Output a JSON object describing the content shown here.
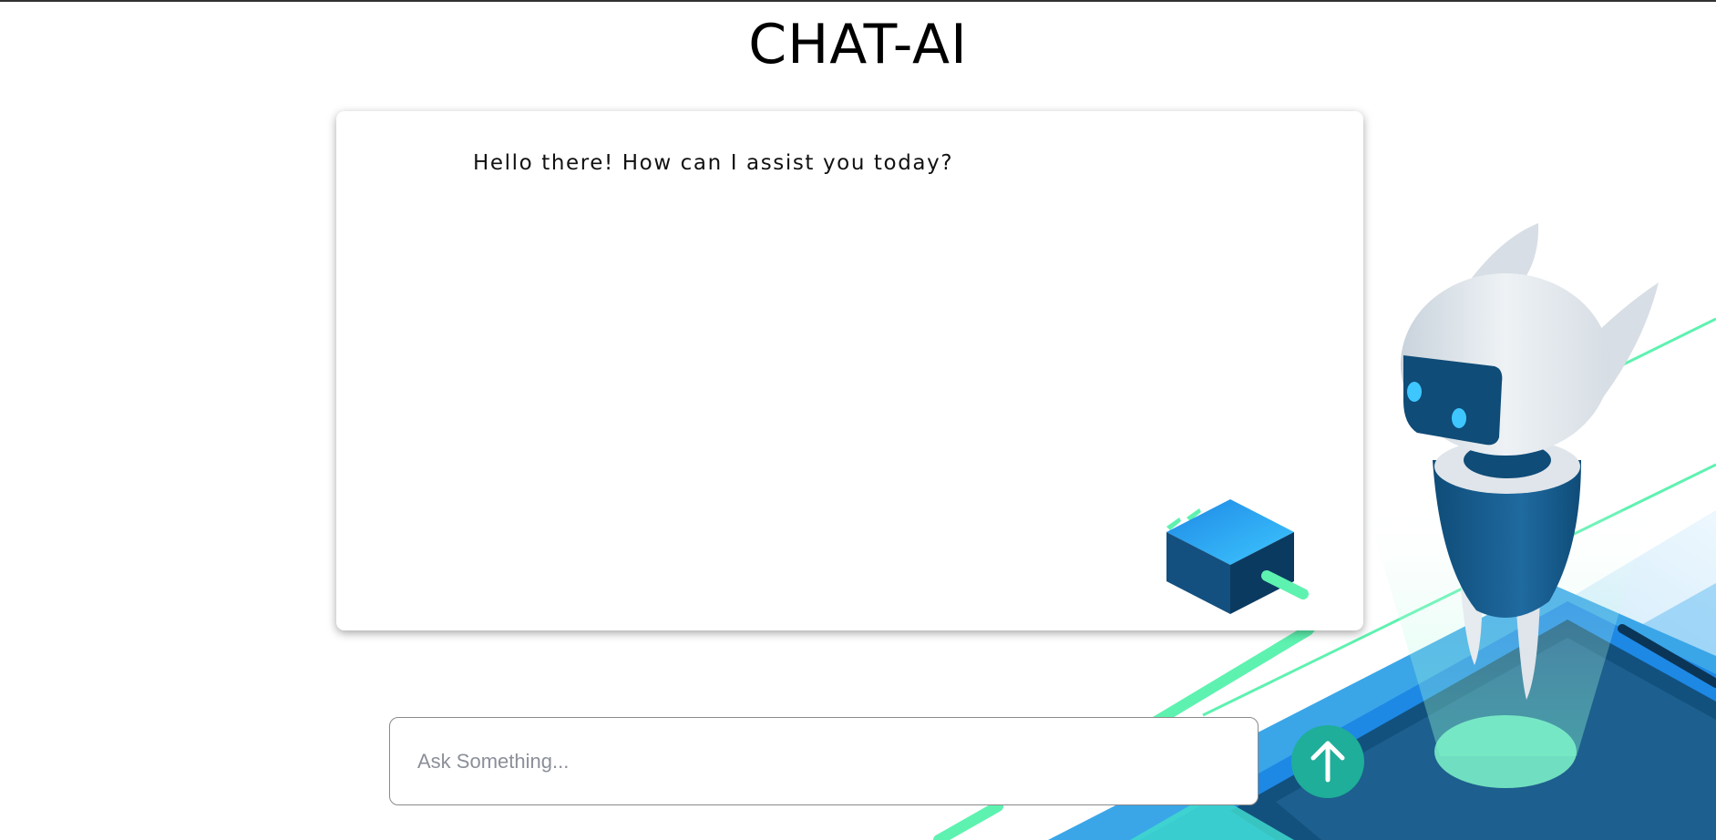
{
  "app": {
    "title": "CHAT-AI"
  },
  "chat": {
    "messages": [
      {
        "role": "assistant",
        "text": "Hello there! How can I assist you today?"
      }
    ]
  },
  "composer": {
    "placeholder": "Ask Something...",
    "value": "",
    "send_icon": "arrow-up-icon"
  },
  "theme": {
    "accent": "#1fae99",
    "illustration_blue": "#1e88e5",
    "illustration_green": "#5ef2b0"
  }
}
